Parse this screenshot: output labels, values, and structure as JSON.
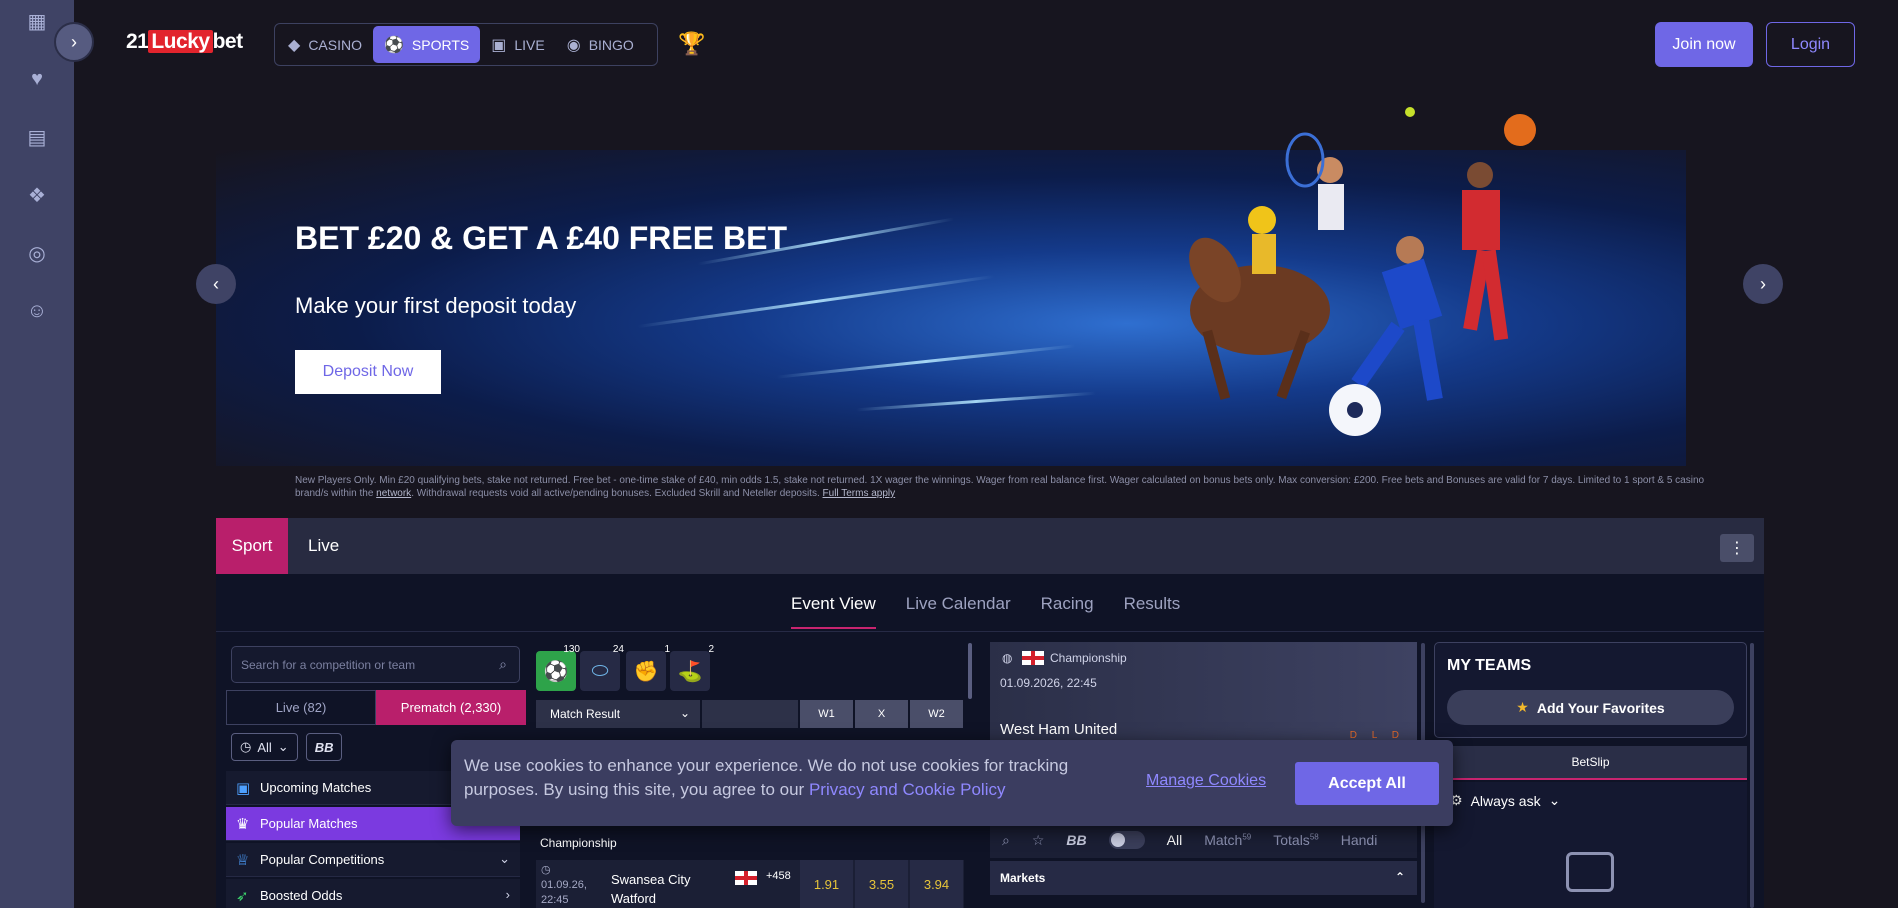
{
  "header": {
    "logo_prefix": "21",
    "logo_mid": "Lucky",
    "logo_suffix": "bet",
    "nav": [
      {
        "label": "CASINO",
        "icon": "cube-icon"
      },
      {
        "label": "SPORTS",
        "icon": "football-icon",
        "active": true
      },
      {
        "label": "LIVE",
        "icon": "cards-icon"
      },
      {
        "label": "BINGO",
        "icon": "bingo-icon"
      }
    ],
    "join_label": "Join now",
    "login_label": "Login"
  },
  "sidebar_icons": [
    "grid-icon",
    "heart-icon",
    "building-icon",
    "gift-icon",
    "target-icon",
    "support-icon"
  ],
  "banner": {
    "title": "BET £20 & GET A £40 FREE BET",
    "subtitle": "Make your first deposit today",
    "cta": "Deposit Now",
    "terms_1": "New Players Only. Min £20 qualifying bets, stake not returned. Free bet - one-time stake of £40, min odds 1.5, stake not returned. 1X wager the winnings. Wager from real balance first. Wager calculated on bonus bets only. Max conversion: £200. Free bets and Bonuses are valid for 7 days. Limited to 1 sport & 5 casino brand/s within the",
    "terms_link_1": "network",
    "terms_2": ". Withdrawal requests void all active/pending bonuses. Excluded Skrill and Neteller deposits.",
    "terms_link_2": "Full Terms apply"
  },
  "sport_bar": {
    "sport": "Sport",
    "live": "Live"
  },
  "subtabs": [
    "Event View",
    "Live Calendar",
    "Racing",
    "Results"
  ],
  "left": {
    "search_placeholder": "Search for a competition or team",
    "live_tab": "Live (82)",
    "prematch_tab": "Prematch (2,330)",
    "filter_all": "All",
    "filter_bb": "BB",
    "menu": [
      "Upcoming Matches",
      "Popular Matches",
      "Popular Competitions",
      "Boosted Odds"
    ]
  },
  "middle": {
    "sports": [
      {
        "icon": "soccer-icon",
        "count": "130"
      },
      {
        "icon": "hockey-puck-icon",
        "count": "24"
      },
      {
        "icon": "boxing-icon",
        "count": "1"
      },
      {
        "icon": "golf-icon",
        "count": "2"
      }
    ],
    "market_select": "Match Result",
    "columns": [
      "W1",
      "X",
      "W2"
    ],
    "league": "Championship",
    "match": {
      "date": "01.09.26,",
      "time": "22:45",
      "home": "Swansea City",
      "away": "Watford",
      "more": "+458",
      "odds": [
        "1.91",
        "3.55",
        "3.94"
      ]
    }
  },
  "event": {
    "league": "Championship",
    "datetime": "01.09.2026, 22:45",
    "team": "West Ham United",
    "form": "D L D",
    "toolbar": [
      "All",
      "Match",
      "Totals",
      "Handi"
    ],
    "toolbar_counts": [
      "59",
      "58"
    ],
    "markets": "Markets"
  },
  "right": {
    "my_teams": "MY TEAMS",
    "add_favorites": "Add Your Favorites",
    "betslip": "BetSlip",
    "always_ask": "Always ask"
  },
  "cookie": {
    "text": "We use cookies to enhance your experience. We do not use cookies for tracking purposes. By using this site, you agree to our",
    "link": "Privacy and Cookie Policy",
    "manage": "Manage Cookies",
    "accept": "Accept All"
  },
  "colors": {
    "accent": "#6f67e6",
    "sport_pink": "#b91f6b",
    "odds_yellow": "#e7c53a"
  }
}
